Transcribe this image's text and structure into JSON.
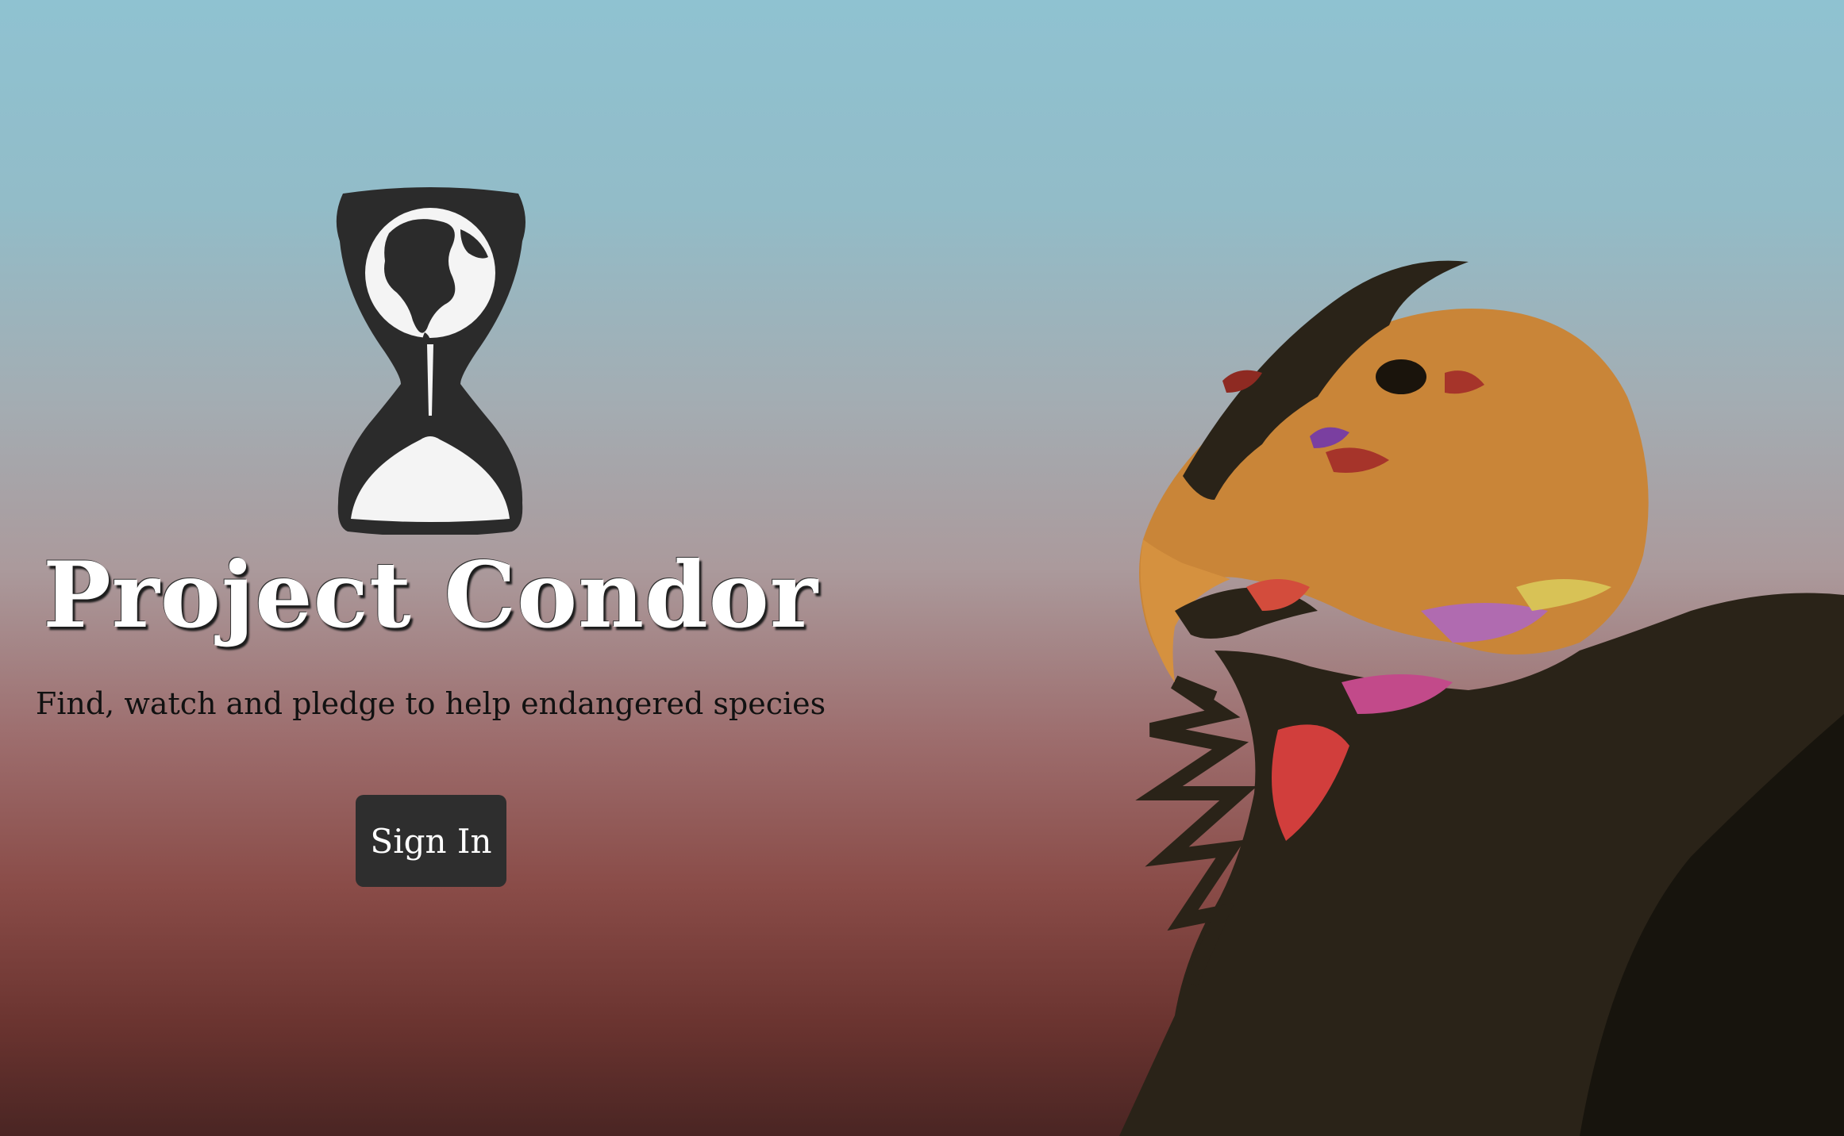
{
  "brand": {
    "title": "Project Condor",
    "tagline": "Find, watch and pledge to help endangered species",
    "logo_icon": "hourglass-earth-icon"
  },
  "auth": {
    "sign_in_label": "Sign In"
  },
  "hero": {
    "illustration": "condor-illustration"
  },
  "colors": {
    "sky_top": "#8fc2d1",
    "ground_bottom": "#4a2523",
    "button_bg": "#2e2e2e",
    "condor_head": "#c98538",
    "condor_body": "#2a2318"
  }
}
